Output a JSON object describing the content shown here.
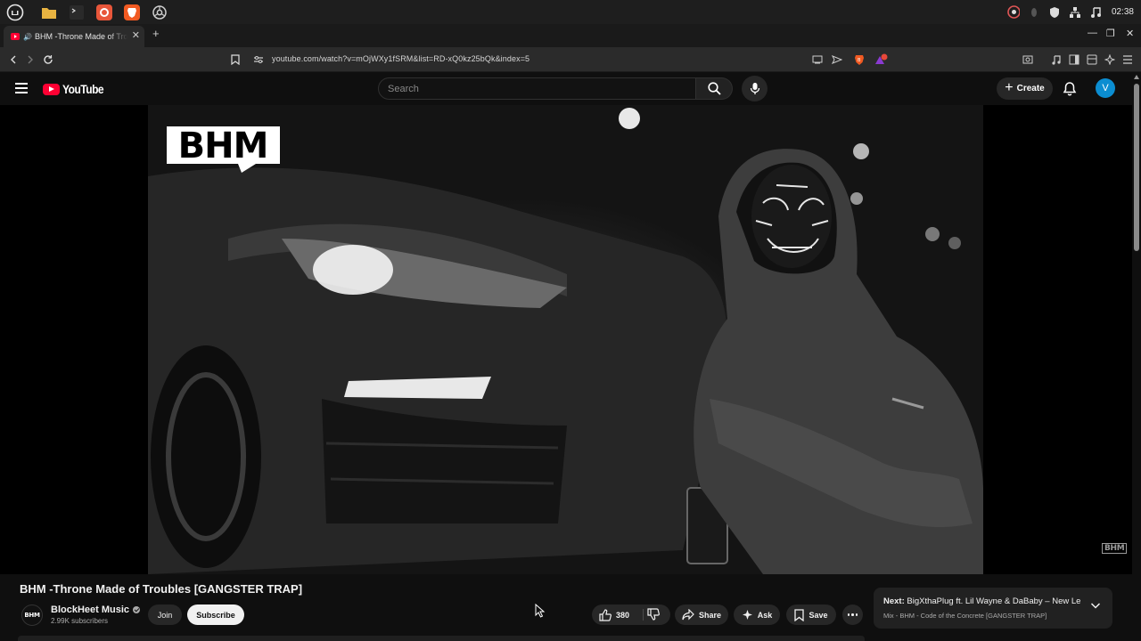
{
  "taskbar": {
    "apps": [
      {
        "name": "mint-menu",
        "color": "#e6e6e6"
      },
      {
        "name": "files",
        "color": "#e8b341"
      },
      {
        "name": "terminal",
        "color": "#3a3a3a"
      },
      {
        "name": "firefox",
        "color": "#e8563a"
      },
      {
        "name": "brave",
        "color": "#f15a22"
      },
      {
        "name": "chromium",
        "color": "#bdbdbd"
      }
    ],
    "clock": "02:38"
  },
  "browser": {
    "tab_title": "BHM -Throne Made of Troubles [GANGSTER TRAP]",
    "url": "youtube.com/watch?v=mOjWXy1fSRM&list=RD-xQ0kz25bQk&index=5",
    "brave_badge": "5"
  },
  "youtube": {
    "logo_text": "YouTube",
    "search_placeholder": "Search",
    "create_label": "Create",
    "avatar_letter": "V"
  },
  "video": {
    "overlay_logo": "BHM",
    "watermark": "BHM",
    "title": "BHM -Throne Made of Troubles [GANGSTER TRAP]"
  },
  "channel": {
    "avatar_text": "BHM",
    "name": "BlockHeet Music",
    "subscribers": "2.99K subscribers",
    "join_label": "Join",
    "subscribe_label": "Subscribe"
  },
  "actions": {
    "likes": "380",
    "share_label": "Share",
    "ask_label": "Ask",
    "save_label": "Save"
  },
  "up_next": {
    "prefix": "Next:",
    "title": "BigXthaPlug ft. Lil Wayne & DaBaby – New Le...",
    "mix": "Mix - BHM - Code of the Concrete [GANGSTER TRAP]"
  },
  "colors": {
    "youtube_red": "#ff0033",
    "avatar_blue": "#0b8dd1",
    "background": "#0f0f0f"
  }
}
